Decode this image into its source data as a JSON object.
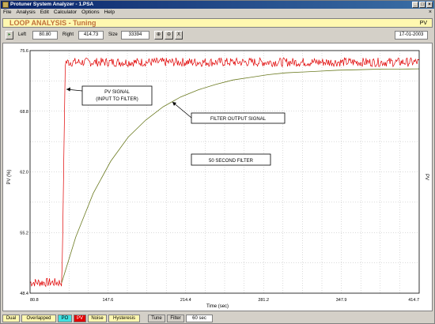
{
  "window": {
    "title": "Protuner System Analyzer - 1.PSA",
    "minimize": "_",
    "maximize": "□",
    "close": "×"
  },
  "menu": {
    "items": [
      "File",
      "Analysis",
      "Edit",
      "Calculator",
      "Options",
      "Help"
    ],
    "close": "×"
  },
  "header": {
    "title": "LOOP ANALYSIS - Tuning",
    "variable": "PV"
  },
  "toolbar": {
    "left_label": "Left",
    "left_value": "80.80",
    "right_label": "Right",
    "right_value": "414.73",
    "size_label": "Size",
    "size_value": "33394",
    "zoom_x_label": "X",
    "date": "17-01-2003"
  },
  "statusbar": {
    "buttons": [
      "Dual",
      "Overlapped",
      "PO",
      "PV",
      "Noise",
      "Hysteresis",
      "Tune",
      "Filter"
    ],
    "filter_value": "60 sec"
  },
  "colors": {
    "pv_signal": "#e00000",
    "filter_output": "#6b7a20",
    "grid": "#b4b4b4",
    "header_bg": "#fff8b0"
  },
  "chart_data": {
    "type": "line",
    "xlabel": "Time (sec)",
    "ylabel": "PV (%)",
    "ylabel_right": "PV",
    "xlim": [
      80.8,
      414.7
    ],
    "ylim": [
      48.4,
      75.6
    ],
    "x_ticks": [
      "80.8",
      "147.6",
      "214.4",
      "281.2",
      "347.9",
      "414.7"
    ],
    "y_ticks": [
      "75.6",
      "68.8",
      "62.0",
      "55.2",
      "48.4"
    ],
    "grid": true,
    "annotations": [
      "PV SIGNAL",
      "(INPUT TO FILTER)",
      "FILTER OUTPUT SIGNAL",
      "50 SECOND FILTER"
    ],
    "series": [
      {
        "role": "pv_signal",
        "x": [
          80.8,
          108.0,
          108.5,
          111.0,
          414.7
        ],
        "y": [
          49.6,
          49.6,
          52.0,
          74.3,
          74.3
        ],
        "noise": 0.5
      },
      {
        "role": "filter_output",
        "x": [
          108.0,
          120,
          135,
          150,
          165,
          180,
          195,
          210,
          225,
          240,
          255,
          270,
          285,
          300,
          315,
          330,
          345,
          360,
          375,
          390,
          405,
          414.7
        ],
        "y": [
          49.6,
          54.7,
          59.6,
          63.2,
          65.9,
          67.8,
          69.3,
          70.4,
          71.2,
          71.8,
          72.3,
          72.6,
          72.9,
          73.1,
          73.2,
          73.3,
          73.4,
          73.45,
          73.5,
          73.52,
          73.54,
          73.55
        ]
      }
    ]
  }
}
